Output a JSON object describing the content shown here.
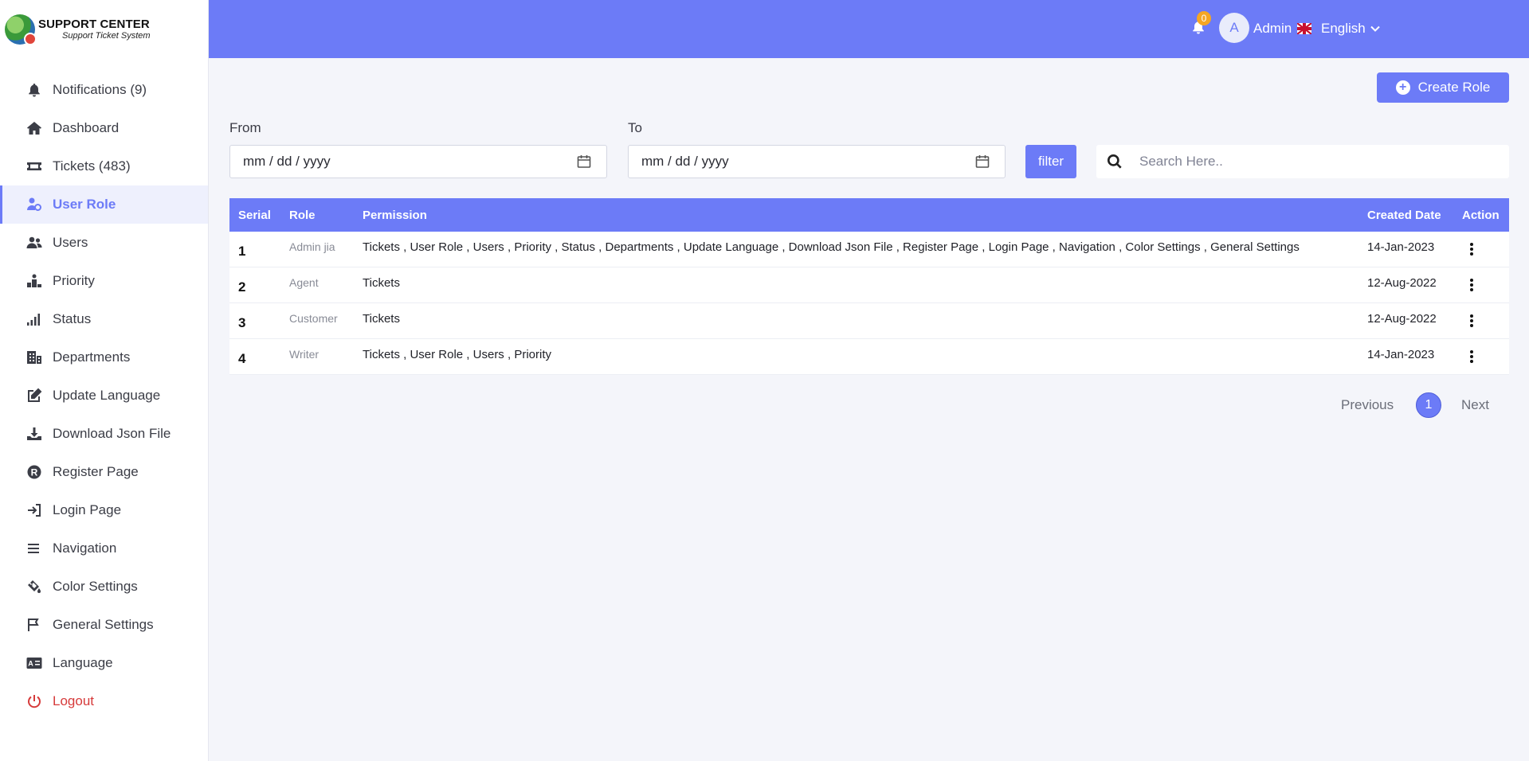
{
  "brand": {
    "title": "SUPPORT CENTER",
    "subtitle": "Support Ticket System"
  },
  "sidebar": {
    "items": [
      {
        "label": "Notifications (9)",
        "icon": "bell-icon"
      },
      {
        "label": "Dashboard",
        "icon": "home-icon"
      },
      {
        "label": "Tickets (483)",
        "icon": "ticket-icon"
      },
      {
        "label": "User Role",
        "icon": "user-role-icon",
        "active": true
      },
      {
        "label": "Users",
        "icon": "users-icon"
      },
      {
        "label": "Priority",
        "icon": "priority-icon"
      },
      {
        "label": "Status",
        "icon": "signal-icon"
      },
      {
        "label": "Departments",
        "icon": "building-icon"
      },
      {
        "label": "Update Language",
        "icon": "edit-icon"
      },
      {
        "label": "Download Json File",
        "icon": "download-icon"
      },
      {
        "label": "Register Page",
        "icon": "registered-icon"
      },
      {
        "label": "Login Page",
        "icon": "sign-in-icon"
      },
      {
        "label": "Navigation",
        "icon": "bars-icon"
      },
      {
        "label": "Color Settings",
        "icon": "paint-bucket-icon"
      },
      {
        "label": "General Settings",
        "icon": "flag-icon"
      },
      {
        "label": "Language",
        "icon": "language-icon"
      },
      {
        "label": "Logout",
        "icon": "power-icon"
      }
    ]
  },
  "topbar": {
    "language": "English",
    "notification_count": "0",
    "avatar_initial": "A",
    "username": "Admin"
  },
  "actions": {
    "create_role": "Create Role"
  },
  "filters": {
    "from_label": "From",
    "to_label": "To",
    "from_value": "mm / dd / yyyy",
    "to_value": "mm / dd / yyyy",
    "filter_button": "filter",
    "search_placeholder": "Search Here.."
  },
  "table": {
    "headers": {
      "serial": "Serial",
      "role": "Role",
      "permission": "Permission",
      "created": "Created Date",
      "action": "Action"
    },
    "rows": [
      {
        "serial": "1",
        "role": "Admin jia",
        "permission": "Tickets , User Role , Users , Priority , Status , Departments , Update Language , Download Json File , Register Page , Login Page , Navigation , Color Settings , General Settings",
        "created": "14-Jan-2023"
      },
      {
        "serial": "2",
        "role": "Agent",
        "permission": "Tickets",
        "created": "12-Aug-2022"
      },
      {
        "serial": "3",
        "role": "Customer",
        "permission": "Tickets",
        "created": "12-Aug-2022"
      },
      {
        "serial": "4",
        "role": "Writer",
        "permission": "Tickets , User Role , Users , Priority",
        "created": "14-Jan-2023"
      }
    ]
  },
  "pagination": {
    "previous": "Previous",
    "current": "1",
    "next": "Next"
  },
  "colors": {
    "primary": "#6c7bf7",
    "logout": "#d63a3a",
    "badge": "#f5a623"
  }
}
